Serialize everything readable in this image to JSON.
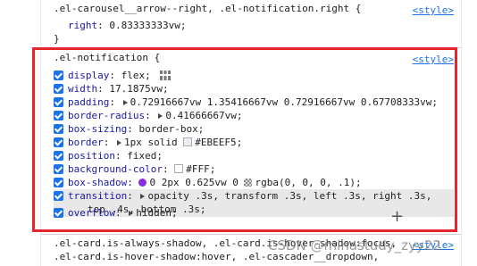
{
  "rule_top": {
    "selector": ".el-carousel__arrow--right, .el-notification.right {",
    "source": "<style>",
    "decl_name": "right",
    "decl_value": "0.83333333vw;",
    "close": "}"
  },
  "rule_main": {
    "selector": ".el-notification {",
    "source": "<style>",
    "props": [
      {
        "name": "display",
        "value": "flex;"
      },
      {
        "name": "width",
        "value": "17.1875vw;"
      },
      {
        "name": "padding",
        "value": "0.72916667vw 1.35416667vw 0.72916667vw 0.67708333vw;"
      },
      {
        "name": "border-radius",
        "value": "0.41666667vw;"
      },
      {
        "name": "box-sizing",
        "value": "border-box;"
      },
      {
        "name": "border",
        "value_pre": "1px solid",
        "value": "#EBEEF5;"
      },
      {
        "name": "position",
        "value": "fixed;"
      },
      {
        "name": "background-color",
        "value": "#FFF;"
      },
      {
        "name": "box-shadow",
        "value_pre": "0 2px 0.625vw 0",
        "value": "rgba(0, 0, 0, .1);"
      },
      {
        "name": "transition",
        "value": "opacity .3s, transform .3s, left .3s, right .3s,",
        "value2": "top .4s, bottom .3s;"
      },
      {
        "name": "overflow",
        "value": "hidden;"
      }
    ],
    "swatch_colors": {
      "border": "#EBEEF5",
      "background": "#FFFFFF"
    }
  },
  "rule_bottom": {
    "selector_line1": ".el-card.is-always-shadow, .el-card.is-hover-shadow:focus,",
    "selector_line2": ".el-card.is-hover-shadow:hover, .el-cascader__dropdown,",
    "source": "<style>"
  },
  "watermark": "CSDN @minastudy_zyy22",
  "colors": {
    "highlight_box": "#e3262d",
    "checkbox": "#1a73e8"
  }
}
